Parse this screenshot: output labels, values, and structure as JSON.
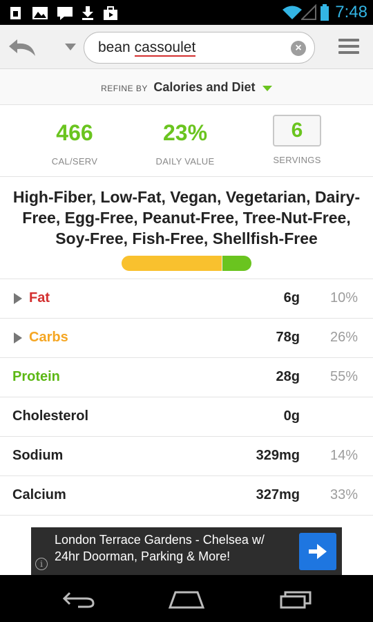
{
  "status_bar": {
    "time": "7:48",
    "notification_icons": [
      "sim-icon",
      "image-icon",
      "chat-icon",
      "download-icon",
      "shopping-bag-icon"
    ],
    "system_icons": [
      "wifi-icon",
      "signal-icon",
      "battery-icon"
    ]
  },
  "toolbar": {
    "search_value": "bean cassoulet",
    "search_word1": "bean ",
    "search_word2": "cassoulet",
    "clear_symbol": "×"
  },
  "refine": {
    "prefix": "REFINE BY",
    "value": "Calories and Diet"
  },
  "stats": [
    {
      "value": "466",
      "label": "CAL/SERV"
    },
    {
      "value": "23%",
      "label": "DAILY VALUE"
    },
    {
      "value": "6",
      "label": "SERVINGS"
    }
  ],
  "diet_labels": "High-Fiber, Low-Fat, Vegan, Vegetarian, Dairy-Free, Egg-Free, Peanut-Free, Tree-Nut-Free, Soy-Free, Fish-Free, Shellfish-Free",
  "diet_bar": {
    "yellow_fraction": 0.77,
    "green_fraction": 0.23
  },
  "nutrients": [
    {
      "name": "Fat",
      "amount": "6g",
      "percent": "10%",
      "color": "#d32f2f",
      "expandable": true
    },
    {
      "name": "Carbs",
      "amount": "78g",
      "percent": "26%",
      "color": "#f5a623",
      "expandable": true
    },
    {
      "name": "Protein",
      "amount": "28g",
      "percent": "55%",
      "color": "#5cb814",
      "expandable": false
    },
    {
      "name": "Cholesterol",
      "amount": "0g",
      "percent": "",
      "color": "#222222",
      "expandable": false
    },
    {
      "name": "Sodium",
      "amount": "329mg",
      "percent": "14%",
      "color": "#222222",
      "expandable": false
    },
    {
      "name": "Calcium",
      "amount": "327mg",
      "percent": "33%",
      "color": "#222222",
      "expandable": false
    }
  ],
  "ad": {
    "line1": "London Terrace Gardens - Chelsea w/",
    "line2": "24hr Doorman, Parking & More!",
    "info": "i"
  },
  "colors": {
    "accent_green": "#6ac41f",
    "accent_yellow": "#f9c12e",
    "status_blue": "#33b5e5"
  }
}
